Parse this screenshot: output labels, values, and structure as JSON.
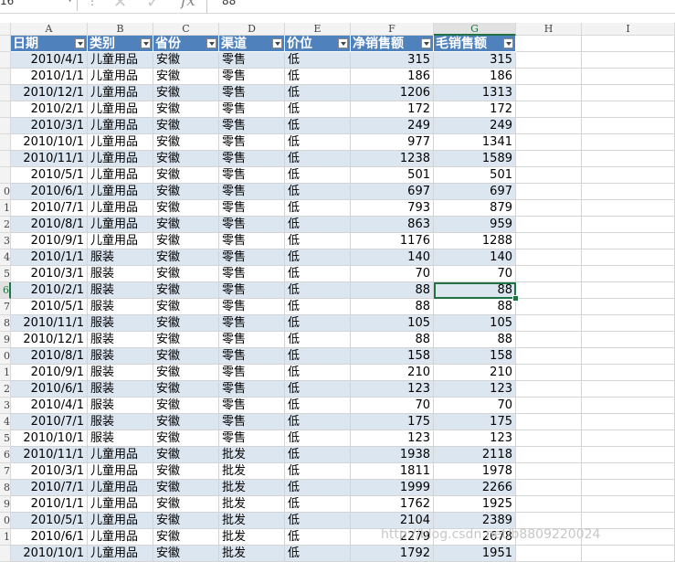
{
  "formula_bar": {
    "name_box_value": "16",
    "cancel_symbol": "✕",
    "enter_symbol": "✓",
    "fx_label": "fx",
    "formula_value": "88"
  },
  "column_letters": [
    "A",
    "B",
    "C",
    "D",
    "E",
    "F",
    "G",
    "H",
    "I"
  ],
  "row_numbers": [
    "",
    "",
    "",
    "",
    "",
    "",
    "",
    "",
    "",
    "0",
    "1",
    "2",
    "3",
    "4",
    "5",
    "6",
    "7",
    "8",
    "9",
    "0",
    "1",
    "2",
    "3",
    "4",
    "5",
    "6",
    "7",
    "8",
    "9",
    "0",
    "1",
    ""
  ],
  "table": {
    "headers": [
      "日期",
      "类别",
      "省份",
      "渠道",
      "价位",
      "净销售额",
      "毛销售额"
    ],
    "rows": [
      [
        "2010/4/1",
        "儿童用品",
        "安徽",
        "零售",
        "低",
        "315",
        "315"
      ],
      [
        "2010/1/1",
        "儿童用品",
        "安徽",
        "零售",
        "低",
        "186",
        "186"
      ],
      [
        "2010/12/1",
        "儿童用品",
        "安徽",
        "零售",
        "低",
        "1206",
        "1313"
      ],
      [
        "2010/2/1",
        "儿童用品",
        "安徽",
        "零售",
        "低",
        "172",
        "172"
      ],
      [
        "2010/3/1",
        "儿童用品",
        "安徽",
        "零售",
        "低",
        "249",
        "249"
      ],
      [
        "2010/10/1",
        "儿童用品",
        "安徽",
        "零售",
        "低",
        "977",
        "1341"
      ],
      [
        "2010/11/1",
        "儿童用品",
        "安徽",
        "零售",
        "低",
        "1238",
        "1589"
      ],
      [
        "2010/5/1",
        "儿童用品",
        "安徽",
        "零售",
        "低",
        "501",
        "501"
      ],
      [
        "2010/6/1",
        "儿童用品",
        "安徽",
        "零售",
        "低",
        "697",
        "697"
      ],
      [
        "2010/7/1",
        "儿童用品",
        "安徽",
        "零售",
        "低",
        "793",
        "879"
      ],
      [
        "2010/8/1",
        "儿童用品",
        "安徽",
        "零售",
        "低",
        "863",
        "959"
      ],
      [
        "2010/9/1",
        "儿童用品",
        "安徽",
        "零售",
        "低",
        "1176",
        "1288"
      ],
      [
        "2010/1/1",
        "服装",
        "安徽",
        "零售",
        "低",
        "140",
        "140"
      ],
      [
        "2010/3/1",
        "服装",
        "安徽",
        "零售",
        "低",
        "70",
        "70"
      ],
      [
        "2010/2/1",
        "服装",
        "安徽",
        "零售",
        "低",
        "88",
        "88"
      ],
      [
        "2010/5/1",
        "服装",
        "安徽",
        "零售",
        "低",
        "88",
        "88"
      ],
      [
        "2010/11/1",
        "服装",
        "安徽",
        "零售",
        "低",
        "105",
        "105"
      ],
      [
        "2010/12/1",
        "服装",
        "安徽",
        "零售",
        "低",
        "88",
        "88"
      ],
      [
        "2010/8/1",
        "服装",
        "安徽",
        "零售",
        "低",
        "158",
        "158"
      ],
      [
        "2010/9/1",
        "服装",
        "安徽",
        "零售",
        "低",
        "210",
        "210"
      ],
      [
        "2010/6/1",
        "服装",
        "安徽",
        "零售",
        "低",
        "123",
        "123"
      ],
      [
        "2010/4/1",
        "服装",
        "安徽",
        "零售",
        "低",
        "70",
        "70"
      ],
      [
        "2010/7/1",
        "服装",
        "安徽",
        "零售",
        "低",
        "175",
        "175"
      ],
      [
        "2010/10/1",
        "服装",
        "安徽",
        "零售",
        "低",
        "123",
        "123"
      ],
      [
        "2010/11/1",
        "儿童用品",
        "安徽",
        "批发",
        "低",
        "1938",
        "2118"
      ],
      [
        "2010/3/1",
        "儿童用品",
        "安徽",
        "批发",
        "低",
        "1811",
        "1978"
      ],
      [
        "2010/7/1",
        "儿童用品",
        "安徽",
        "批发",
        "低",
        "1999",
        "2266"
      ],
      [
        "2010/1/1",
        "儿童用品",
        "安徽",
        "批发",
        "低",
        "1762",
        "1925"
      ],
      [
        "2010/5/1",
        "儿童用品",
        "安徽",
        "批发",
        "低",
        "2104",
        "2389"
      ],
      [
        "2010/6/1",
        "儿童用品",
        "安徽",
        "批发",
        "低",
        "2279",
        "2678"
      ],
      [
        "2010/10/1",
        "儿童用品",
        "安徽",
        "批发",
        "低",
        "1792",
        "1951"
      ]
    ]
  },
  "watermark": "http://blog.csdn.net/b8809220024",
  "colors": {
    "header_fill": "#4f81bd",
    "band_fill": "#dce6f1",
    "selection": "#217346"
  }
}
